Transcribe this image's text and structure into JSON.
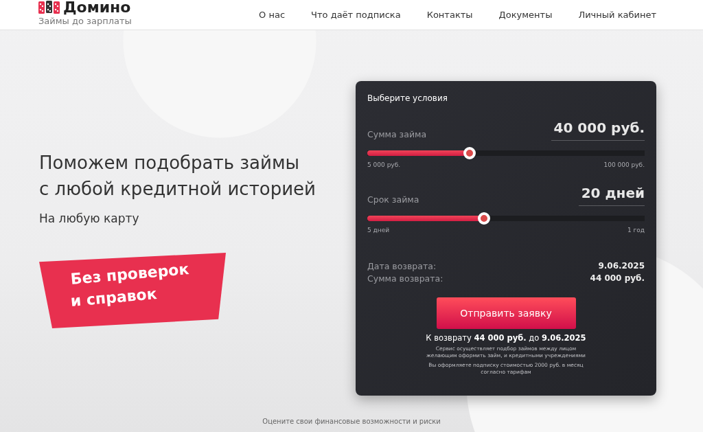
{
  "header": {
    "logo": {
      "name": "Домино",
      "tagline": "Займы до зарплаты"
    },
    "nav": [
      {
        "label": "О нас"
      },
      {
        "label": "Что даёт подписка"
      },
      {
        "label": "Контакты"
      },
      {
        "label": "Документы"
      },
      {
        "label": "Личный кабинет"
      }
    ]
  },
  "hero": {
    "title_lines": [
      "Поможем подобрать займы",
      "с любой кредитной историей"
    ],
    "subtitle": "На любую карту",
    "badge_lines": [
      "Без проверок",
      "и справок"
    ]
  },
  "calculator": {
    "title": "Выберите условия",
    "sliders": [
      {
        "label": "Сумма займа",
        "value": "40 000 руб.",
        "level": 0.37,
        "min": "5 000 руб.",
        "max": "100 000 руб."
      },
      {
        "label": "Срок займа",
        "value": "20 дней",
        "level": 0.42,
        "min": "5 дней",
        "max": "1 год"
      }
    ],
    "summary": [
      {
        "label": "Дата возврата:",
        "value": "9.06.2025"
      },
      {
        "label": "Сумма возврата:",
        "value": "44 000 руб."
      }
    ],
    "submit_button": "Отправить заявку",
    "total": "К возврату **44 000 руб.** до **9.06.2025**",
    "notes": [
      "Сервис осуществляет подбор займов между лицом желающим оформить займ, и кредитными учреждениями",
      "Вы оформляете подписку стоимостью 2000 руб. в месяц согласно тарифам"
    ]
  },
  "footer_text": "Оцените свои финансовые возможности и риски"
}
